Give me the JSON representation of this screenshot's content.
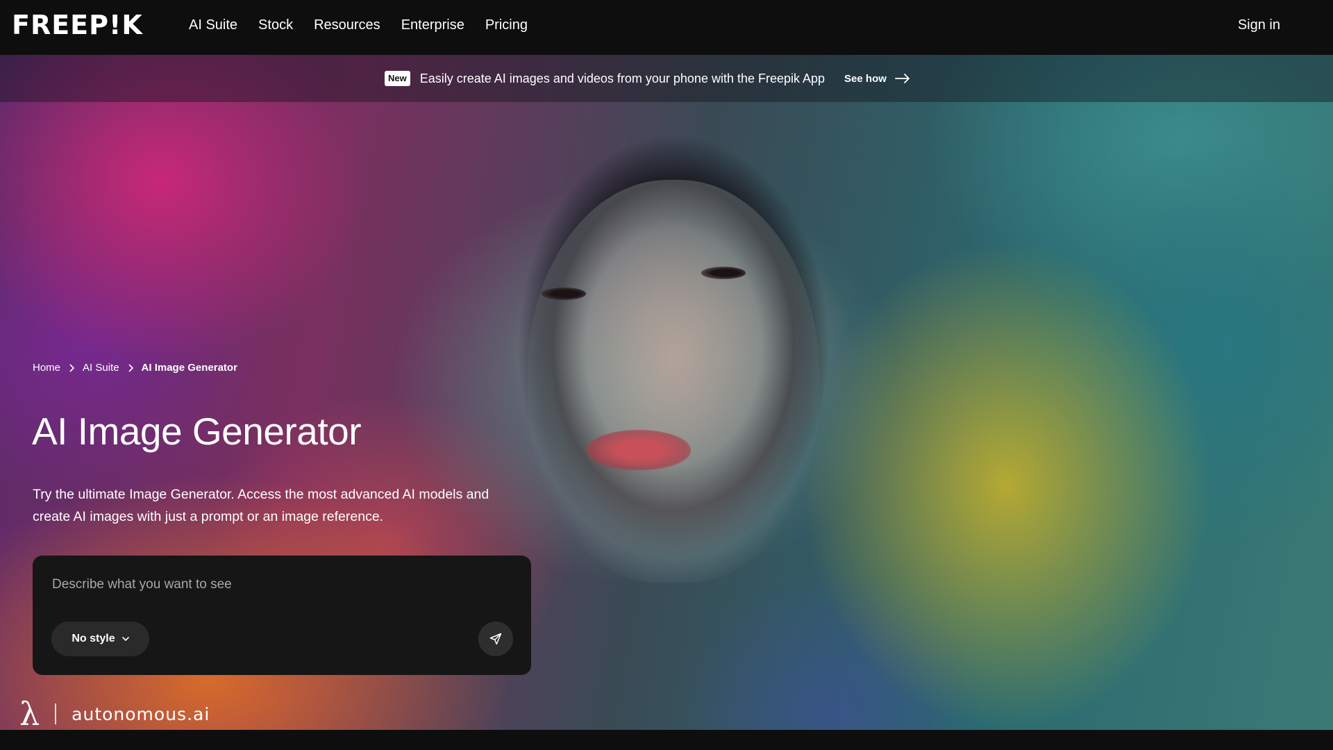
{
  "brand": {
    "logo_text": "FREEP!K"
  },
  "nav": {
    "links": [
      "AI Suite",
      "Stock",
      "Resources",
      "Enterprise",
      "Pricing"
    ],
    "sign_in": "Sign in"
  },
  "banner": {
    "badge": "New",
    "text": "Easily create AI images and videos from your phone with the Freepik App",
    "cta": "See how"
  },
  "breadcrumb": [
    "Home",
    "AI Suite",
    "AI Image Generator"
  ],
  "hero": {
    "title": "AI Image Generator",
    "description": "Try the ultimate Image Generator. Access the most advanced AI models and create AI images with just a prompt or an image reference."
  },
  "prompt": {
    "placeholder": "Describe what you want to see",
    "value": "",
    "style_label": "No style"
  },
  "watermark": {
    "symbol": "λ",
    "text": "autonomous.ai"
  },
  "icons": [
    "chevron-right-icon",
    "arrow-right-icon",
    "chevron-down-icon",
    "send-icon"
  ]
}
